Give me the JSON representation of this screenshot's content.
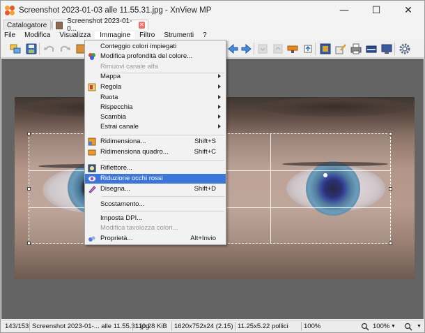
{
  "window": {
    "title": "Screenshot 2023-01-03 alle 11.55.31.jpg - XnView MP",
    "controls": {
      "minimize": "—",
      "maximize": "☐",
      "close": "✕"
    }
  },
  "tabs": [
    {
      "label": "Catalogatore",
      "close": "✕"
    },
    {
      "label": "Screenshot 2023-01-0...",
      "close": "✕"
    }
  ],
  "menubar": [
    "File",
    "Modifica",
    "Visualizza",
    "Immagine",
    "Filtro",
    "Strumenti",
    "?"
  ],
  "image_menu": {
    "items": [
      {
        "label": "Conteggio colori impiegati",
        "shortcut": "",
        "submenu": false,
        "disabled": false,
        "icon": ""
      },
      {
        "label": "Modifica profondità del colore...",
        "shortcut": "",
        "submenu": false,
        "disabled": false,
        "icon": "color-depth-icon"
      },
      {
        "label": "Rimuovi canale alfa",
        "shortcut": "",
        "submenu": false,
        "disabled": true,
        "icon": ""
      },
      {
        "label": "Mappa",
        "shortcut": "",
        "submenu": true,
        "disabled": false,
        "icon": ""
      },
      {
        "label": "Regola",
        "shortcut": "",
        "submenu": true,
        "disabled": false,
        "icon": "adjust-icon"
      },
      {
        "label": "Ruota",
        "shortcut": "",
        "submenu": true,
        "disabled": false,
        "icon": ""
      },
      {
        "label": "Rispecchia",
        "shortcut": "",
        "submenu": true,
        "disabled": false,
        "icon": ""
      },
      {
        "label": "Scambia",
        "shortcut": "",
        "submenu": true,
        "disabled": false,
        "icon": ""
      },
      {
        "label": "Estrai canale",
        "shortcut": "",
        "submenu": true,
        "disabled": false,
        "icon": ""
      },
      {
        "label": "Ridimensiona...",
        "shortcut": "Shift+S",
        "submenu": false,
        "disabled": false,
        "icon": "resize-icon"
      },
      {
        "label": "Ridimensiona quadro...",
        "shortcut": "Shift+C",
        "submenu": false,
        "disabled": false,
        "icon": "canvas-resize-icon"
      },
      {
        "label": "Riflettore...",
        "shortcut": "",
        "submenu": false,
        "disabled": false,
        "icon": "spotlight-icon"
      },
      {
        "label": "Riduzione occhi rossi",
        "shortcut": "",
        "submenu": false,
        "disabled": false,
        "icon": "red-eye-icon",
        "highlighted": true
      },
      {
        "label": "Disegna...",
        "shortcut": "Shift+D",
        "submenu": false,
        "disabled": false,
        "icon": "draw-icon"
      },
      {
        "label": "Scostamento...",
        "shortcut": "",
        "submenu": false,
        "disabled": false,
        "icon": ""
      },
      {
        "label": "Imposta DPI...",
        "shortcut": "",
        "submenu": false,
        "disabled": false,
        "icon": ""
      },
      {
        "label": "Modifica tavolozza colori...",
        "shortcut": "",
        "submenu": false,
        "disabled": true,
        "icon": ""
      },
      {
        "label": "Proprietà...",
        "shortcut": "Alt+Invio",
        "submenu": false,
        "disabled": false,
        "icon": "properties-icon"
      }
    ]
  },
  "toolbar": {
    "icons": [
      "browser-icon",
      "save-icon",
      "undo-icon",
      "redo-icon",
      "image-icon",
      "previous-icon",
      "next-icon",
      "first-page-icon",
      "last-page-icon",
      "slideshow-icon",
      "open-external-icon",
      "fit-icon",
      "edit-icon",
      "print-icon",
      "scan-icon",
      "monitor-icon",
      "settings-icon"
    ]
  },
  "statusbar": {
    "position": "143/153",
    "filename": "Screenshot 2023-01-... alle 11.55.31.jpg",
    "filesize": "110.28 KiB",
    "dimensions": "1620x752x24 (2.15)",
    "print_size": "11.25x5.22 pollici",
    "zoom_percent": "100%",
    "zoom_value": "100%"
  }
}
